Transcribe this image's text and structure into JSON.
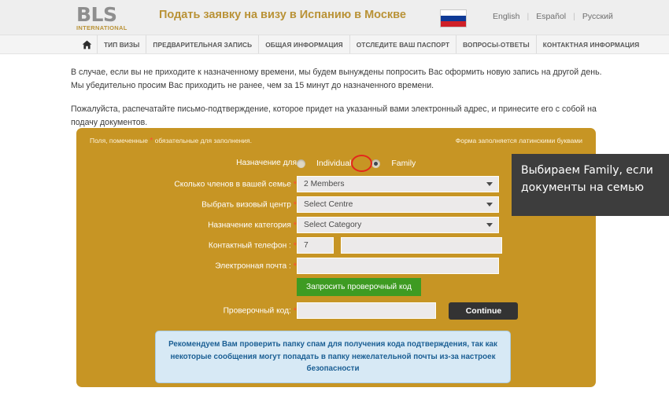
{
  "header": {
    "logo_main": "BLS",
    "logo_sub": "INTERNATIONAL",
    "title": "Подать заявку на визу в Испанию в Москве",
    "flag_icon": "russia-flag-icon",
    "languages": [
      {
        "label": "English"
      },
      {
        "label": "Español"
      },
      {
        "label": "Русский"
      }
    ],
    "lang_separator": "|"
  },
  "nav": {
    "home_icon": "home-icon",
    "items": [
      {
        "label": "ТИП ВИЗЫ"
      },
      {
        "label": "ПРЕДВАРИТЕЛЬНАЯ ЗАПИСЬ"
      },
      {
        "label": "ОБЩАЯ ИНФОРМАЦИЯ"
      },
      {
        "label": "ОТСЛЕДИТЕ ВАШ ПАСПОРТ"
      },
      {
        "label": "ВОПРОСЫ-ОТВЕТЫ"
      },
      {
        "label": "КОНТАКТНАЯ ИНФОРМАЦИЯ"
      }
    ]
  },
  "body": {
    "paragraph1": "В случае, если вы не приходите к назначенному времени, мы будем вынуждены попросить Вас оформить новую запись на другой день. Мы убедительно просим Вас приходить не ранее, чем за 15 минут до назначенного времени.",
    "paragraph2": "Пожалуйста, распечатайте письмо-подтверждение, которое придет на указанный вами электронный адрес, и принесите его с собой на подачу документов."
  },
  "form": {
    "note_left_pre": "Поля, помеченные",
    "note_left_star": "*",
    "note_left_post": "обязательные для заполнения.",
    "note_right": "Форма заполняется латинскими буквами",
    "appointment_for": {
      "label": "Назначение для",
      "options": [
        {
          "label": "Individual",
          "selected": false
        },
        {
          "label": "Family",
          "selected": true
        }
      ]
    },
    "members": {
      "label": "Сколько членов в вашей семье",
      "required": "*",
      "value": "2 Members",
      "icon": "chevron-down-icon"
    },
    "centre": {
      "label": "Выбрать визовый центр",
      "required": "*",
      "value": "Select Centre",
      "icon": "chevron-down-icon"
    },
    "category": {
      "label": "Назначение категория",
      "required": "*",
      "value": "Select Category",
      "icon": "chevron-down-icon"
    },
    "phone": {
      "label": "Контактный телефон :",
      "required": "*",
      "prefix_value": "7",
      "value": "",
      "placeholder": ""
    },
    "email": {
      "label": "Электронная почта :",
      "required": "*",
      "value": "",
      "placeholder": ""
    },
    "request_code_button": "Запросить проверочный код",
    "code": {
      "label": "Проверочный код:",
      "required": "*",
      "value": "",
      "placeholder": ""
    },
    "continue_button": "Continue",
    "info_box": "Рекомендуем Вам проверить папку спам для получения кода подтверждения, так как некоторые сообщения могут попадать в папку нежелательной почты из-за настроек безопасности"
  },
  "annotation": {
    "text": "Выбираем Family, если документы на семью",
    "highlight_color": "#e4261b",
    "background_color": "#3d3d3d"
  },
  "colors": {
    "panel": "#c79524",
    "brand_gold": "#b99236",
    "green_button": "#3e9b22",
    "dark_button": "#333333",
    "info_blue": "#1b5f94"
  }
}
